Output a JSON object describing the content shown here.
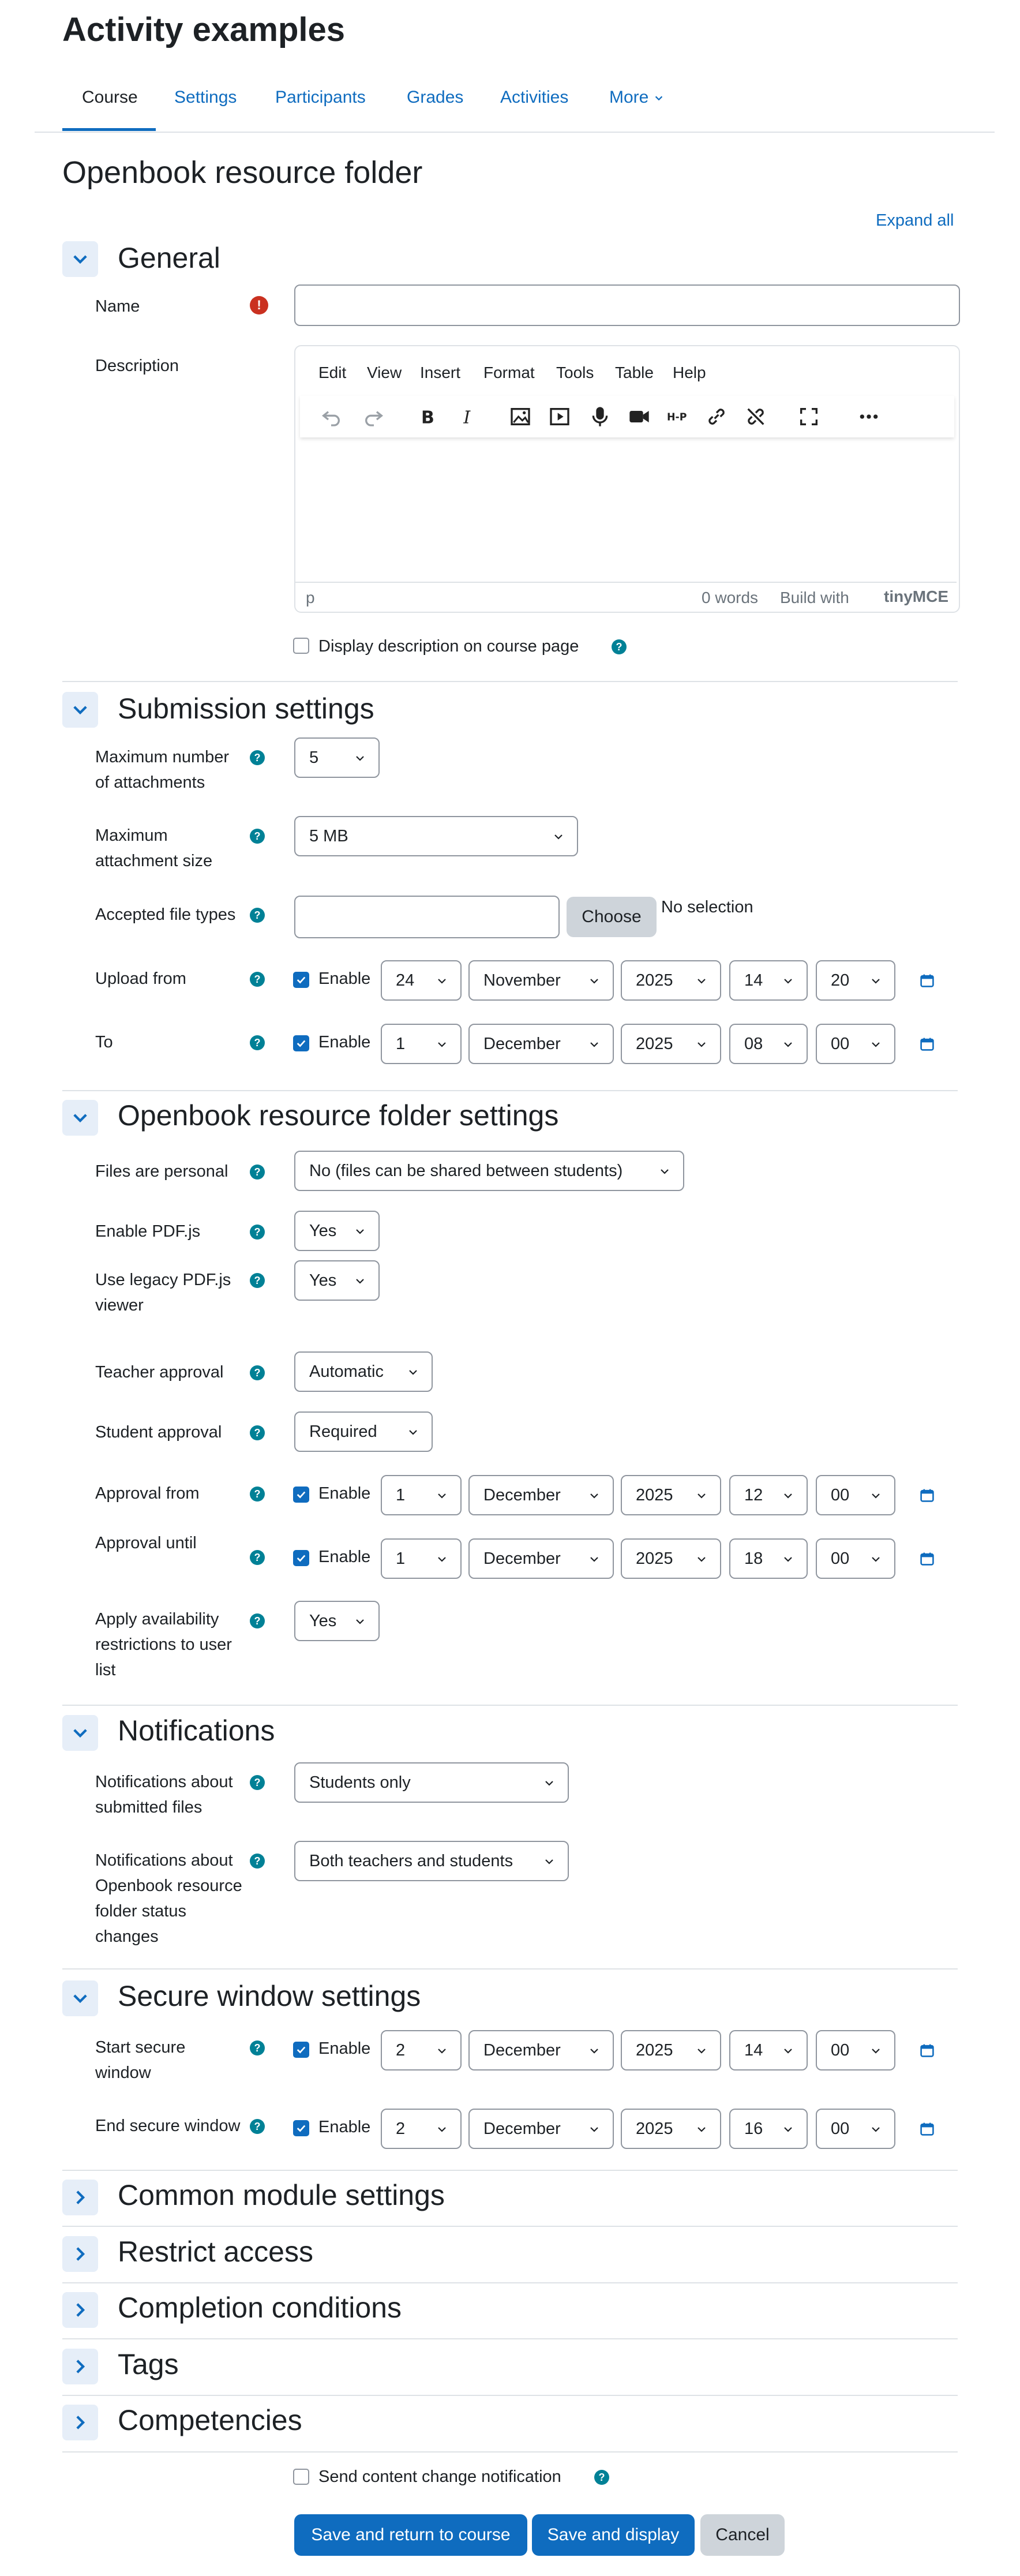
{
  "header": {
    "title": "Activity examples"
  },
  "tabs": [
    {
      "label": "Course"
    },
    {
      "label": "Settings"
    },
    {
      "label": "Participants"
    },
    {
      "label": "Grades"
    },
    {
      "label": "Activities"
    },
    {
      "label": "More"
    }
  ],
  "page_title": "Openbook resource folder",
  "expand_all": "Expand all",
  "general": {
    "title": "General",
    "name_label": "Name",
    "name_value": "",
    "description_label": "Description",
    "editor_menu": [
      "Edit",
      "View",
      "Insert",
      "Format",
      "Tools",
      "Table",
      "Help"
    ],
    "status_path": "p",
    "words": "0 words",
    "build_with": "Build with",
    "tinymce": "tinyMCE",
    "display_desc": "Display description on course page"
  },
  "submission": {
    "title": "Submission settings",
    "max_attach_label": "Maximum number of attachments",
    "max_attach_value": "5",
    "max_size_label": "Maximum attachment size",
    "max_size_value": "5 MB",
    "accepted_label": "Accepted file types",
    "choose": "Choose",
    "no_selection": "No selection",
    "upload_from_label": "Upload from",
    "upload_from": {
      "enable": "Enable",
      "day": "24",
      "month": "November",
      "year": "2025",
      "hour": "14",
      "minute": "20"
    },
    "to_label": "To",
    "to": {
      "enable": "Enable",
      "day": "1",
      "month": "December",
      "year": "2025",
      "hour": "08",
      "minute": "00"
    }
  },
  "obf": {
    "title": "Openbook resource folder settings",
    "personal_label": "Files are personal",
    "personal_value": "No (files can be shared between students)",
    "pdfjs_label": "Enable PDF.js",
    "pdfjs_value": "Yes",
    "legacy_label": "Use legacy PDF.js viewer",
    "legacy_value": "Yes",
    "teacher_label": "Teacher approval",
    "teacher_value": "Automatic",
    "student_label": "Student approval",
    "student_value": "Required",
    "approval_from_label": "Approval from",
    "approval_from": {
      "enable": "Enable",
      "day": "1",
      "month": "December",
      "year": "2025",
      "hour": "12",
      "minute": "00"
    },
    "approval_until_label": "Approval until",
    "approval_until": {
      "enable": "Enable",
      "day": "1",
      "month": "December",
      "year": "2025",
      "hour": "18",
      "minute": "00"
    },
    "apply_label": "Apply availability restrictions to user list",
    "apply_value": "Yes"
  },
  "notifications": {
    "title": "Notifications",
    "submitted_label": "Notifications about submitted files",
    "submitted_value": "Students only",
    "status_label": "Notifications about Openbook resource folder status changes",
    "status_value": "Both teachers and students"
  },
  "secure": {
    "title": "Secure window settings",
    "start_label": "Start secure window",
    "start": {
      "enable": "Enable",
      "day": "2",
      "month": "December",
      "year": "2025",
      "hour": "14",
      "minute": "00"
    },
    "end_label": "End secure window",
    "end": {
      "enable": "Enable",
      "day": "2",
      "month": "December",
      "year": "2025",
      "hour": "16",
      "minute": "00"
    }
  },
  "collapsed_sections": [
    "Common module settings",
    "Restrict access",
    "Completion conditions",
    "Tags",
    "Competencies"
  ],
  "footer": {
    "send_notification": "Send content change notification",
    "save_return": "Save and return to course",
    "save_display": "Save and display",
    "cancel": "Cancel"
  },
  "colors": {
    "accent": "#0f6cbf",
    "help": "#008196",
    "required": "#ca3120"
  }
}
